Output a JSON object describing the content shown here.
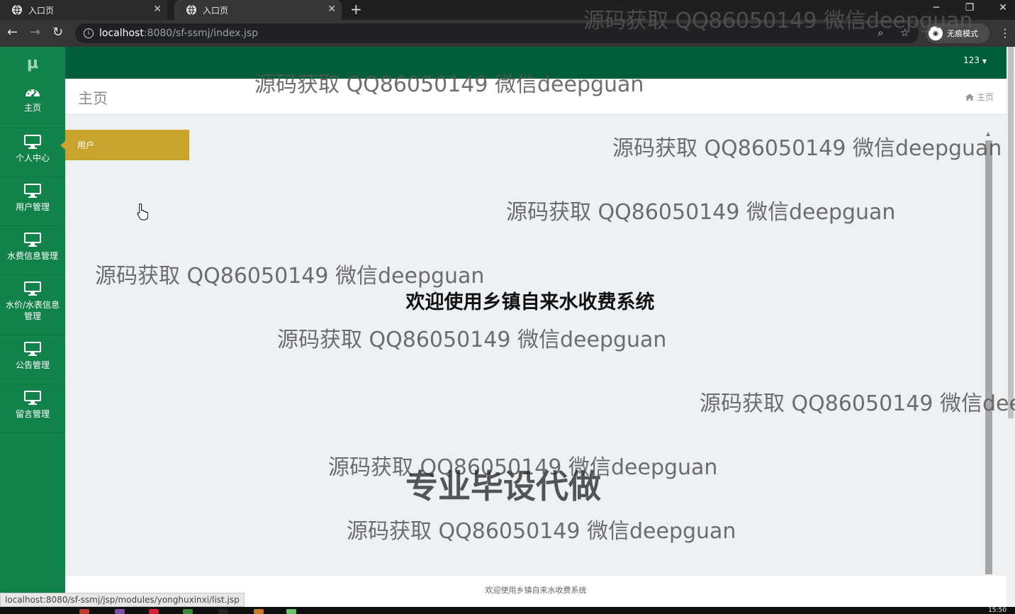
{
  "browser": {
    "tabs": [
      {
        "title": "入口页",
        "active": false
      },
      {
        "title": "入口页",
        "active": true
      }
    ],
    "new_tab": "+",
    "url_host": "localhost",
    "url_rest": ":8080/sf-ssmj/index.jsp",
    "incognito_label": "无痕模式",
    "status_url": "localhost:8080/sf-ssmj/jsp/modules/yonghuxinxi/list.jsp"
  },
  "app": {
    "logo": "μ",
    "sidebar": {
      "items": [
        {
          "label": "主页",
          "icon": "dashboard-icon"
        },
        {
          "label": "个人中心",
          "icon": "monitor-icon"
        },
        {
          "label": "用户管理",
          "icon": "monitor-icon"
        },
        {
          "label": "水费信息管理",
          "icon": "monitor-icon"
        },
        {
          "label": "水价/水表信息管理",
          "icon": "monitor-icon"
        },
        {
          "label": "公告管理",
          "icon": "monitor-icon"
        },
        {
          "label": "留言管理",
          "icon": "monitor-icon"
        }
      ]
    },
    "user_menu": "123",
    "page_title": "主页",
    "breadcrumb": "主页",
    "flyout_item": "用户",
    "welcome": "欢迎使用乡镇自来水收费系统",
    "footer": "欢迎使用乡镇自来水收费系统"
  },
  "watermark": {
    "text": "源码获取 QQ86050149 微信deepguan",
    "text_cut": "源码获取 QQ86050149 微信dee",
    "big_text": "专业毕设代做"
  },
  "taskbar": {
    "clock": "15:50"
  },
  "colors": {
    "sidebar": "#12824b",
    "topbar": "#005e3a",
    "flyout": "#c9a42d",
    "content_bg": "#eef1f4"
  }
}
